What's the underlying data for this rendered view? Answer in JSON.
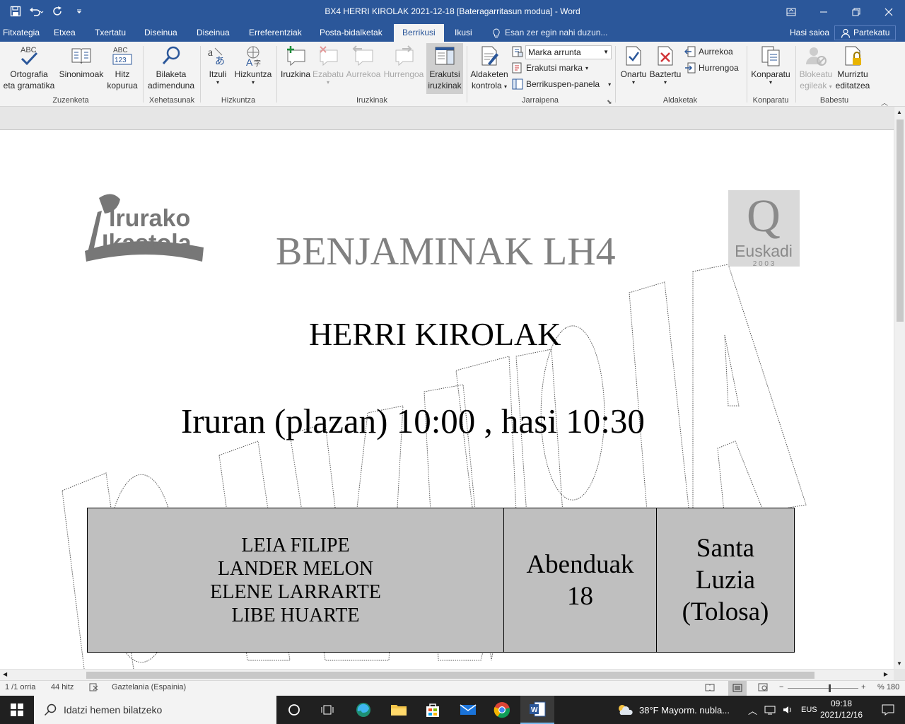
{
  "window": {
    "title": "BX4 HERRI KIROLAK 2021-12-18 [Bateragarritasun modua] - Word",
    "accent": "#2b579a"
  },
  "tabs": [
    {
      "label": "Fitxategia"
    },
    {
      "label": "Etxea"
    },
    {
      "label": "Txertatu"
    },
    {
      "label": "Diseinua"
    },
    {
      "label": "Diseinua"
    },
    {
      "label": "Erreferentziak"
    },
    {
      "label": "Posta-bidalketak"
    },
    {
      "label": "Berrikusi",
      "active": true
    },
    {
      "label": "Ikusi"
    }
  ],
  "tell_me": "Esan zer egin nahi duzun...",
  "sign_in": "Hasi saioa",
  "share": "Partekatu",
  "ribbon": {
    "spelling": {
      "line1": "Ortografia",
      "line2": "eta gramatika"
    },
    "thesaurus": "Sinonimoak",
    "wordcount": {
      "line1": "Hitz",
      "line2": "kopurua"
    },
    "smart_lookup": {
      "line1": "Bilaketa",
      "line2": "adimenduna"
    },
    "translate": "Itzuli",
    "language": "Hizkuntza",
    "new_comment": "Iruzkina",
    "delete_comment": "Ezabatu",
    "prev_comment": "Aurrekoa",
    "next_comment": "Hurrengoa",
    "show_comments": {
      "line1": "Erakutsi",
      "line2": "iruzkinak"
    },
    "track_changes": {
      "line1": "Aldaketen",
      "line2": "kontrola"
    },
    "markup_dropdown": "Marka arrunta",
    "show_markup": "Erakutsi marka",
    "reviewing_pane": "Berrikuspen-panela",
    "accept": "Onartu",
    "reject": "Baztertu",
    "previous": "Aurrekoa",
    "next": "Hurrengoa",
    "compare": "Konparatu",
    "block_authors": {
      "line1": "Blokeatu",
      "line2": "egileak"
    },
    "restrict_editing": {
      "line1": "Murriztu",
      "line2": "editatzea"
    },
    "groups": {
      "proofing": "Zuzenketa",
      "insights": "Xehetasunak",
      "language": "Hizkuntza",
      "comments": "Iruzkinak",
      "tracking": "Jarraipena",
      "changes": "Aldaketak",
      "compare": "Konparatu",
      "protect": "Babestu"
    }
  },
  "document": {
    "logo_left": {
      "line1": "Irurako",
      "line2": "Ikastola"
    },
    "logo_right": {
      "letter": "Q",
      "word": "Euskadi",
      "year": "2 0 0 3"
    },
    "heading": "BENJAMINAK LH4",
    "subheading": "HERRI KIROLAK",
    "location_line": "Iruran (plazan) 10:00 ,  hasi  10:30",
    "table": {
      "names": [
        "LEIA FILIPE",
        "LANDER MELON",
        "ELENE LARRARTE",
        "LIBE HUARTE"
      ],
      "date": {
        "line1": "Abenduak",
        "line2": "18"
      },
      "place": {
        "line1": "Santa",
        "line2": "Luzia",
        "line3": "(Tolosa)"
      }
    }
  },
  "status": {
    "page": "1 /1 orria",
    "words": "44 hitz",
    "language": "Gaztelania (Espainia)",
    "zoom": "% 180"
  },
  "taskbar": {
    "search_placeholder": "Idatzi hemen bilatzeko",
    "weather": "38°F  Mayorm. nubla...",
    "lang": "EUS",
    "time": "09:18",
    "date": "2021/12/16"
  }
}
